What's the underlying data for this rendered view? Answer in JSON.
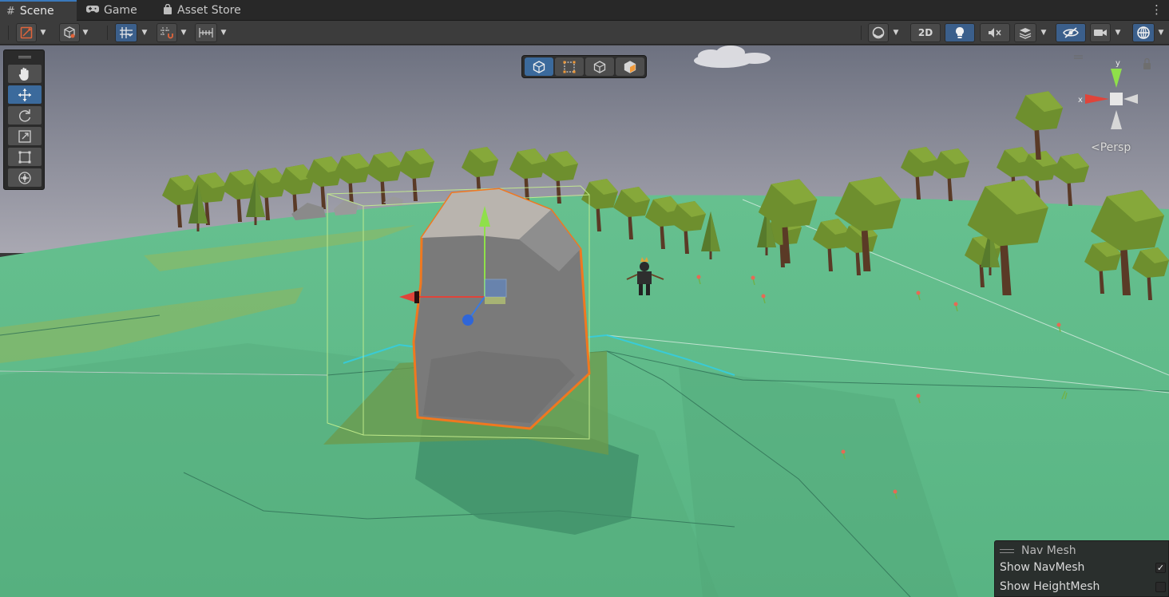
{
  "tabs": [
    {
      "label": "Scene",
      "icon": "grid-icon",
      "active": true
    },
    {
      "label": "Game",
      "icon": "gamepad-icon",
      "active": false
    },
    {
      "label": "Asset Store",
      "icon": "bag-icon",
      "active": false
    }
  ],
  "toolbar": {
    "two_d_label": "2D"
  },
  "viewport": {
    "projection_label": "<Persp",
    "gizmo_axis_x": "x",
    "gizmo_axis_y": "y"
  },
  "nav_mesh_overlay": {
    "title": "Nav Mesh",
    "options": [
      {
        "label": "Show NavMesh",
        "checked": true
      },
      {
        "label": "Show HeightMesh",
        "checked": false
      }
    ]
  },
  "colors": {
    "accent": "#3b6a9c",
    "selection_outline": "#f07820",
    "ground": "#5cb887",
    "sky_top": "#6d7180",
    "sky_bottom": "#a7a6b0"
  }
}
